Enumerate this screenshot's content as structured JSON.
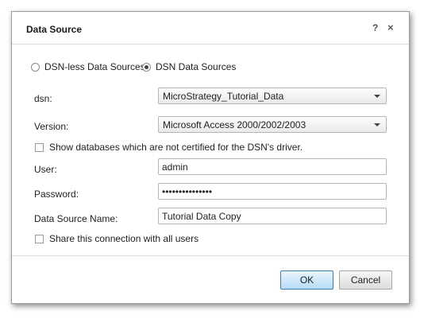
{
  "dialog": {
    "title": "Data Source",
    "help_icon": "?",
    "close_icon": "×"
  },
  "source_type": {
    "options": [
      {
        "label": "DSN-less Data Sources",
        "selected": false
      },
      {
        "label": "DSN Data Sources",
        "selected": true
      }
    ]
  },
  "fields": {
    "dsn_label": "dsn:",
    "dsn_value": "MicroStrategy_Tutorial_Data",
    "version_label": "Version:",
    "version_value": "Microsoft Access 2000/2002/2003",
    "show_uncertified_label": "Show databases which are not certified for the DSN's driver.",
    "show_uncertified_checked": false,
    "user_label": "User:",
    "user_value": "admin",
    "password_label": "Password:",
    "password_value": "•••••••••••••••",
    "data_source_name_label": "Data Source Name:",
    "data_source_name_value": "Tutorial Data Copy",
    "share_label": "Share this connection with all users",
    "share_checked": false
  },
  "buttons": {
    "ok_label": "OK",
    "cancel_label": "Cancel"
  },
  "icons": {
    "help": "help-icon",
    "close": "close-icon",
    "dropdown": "chevron-down-icon"
  }
}
